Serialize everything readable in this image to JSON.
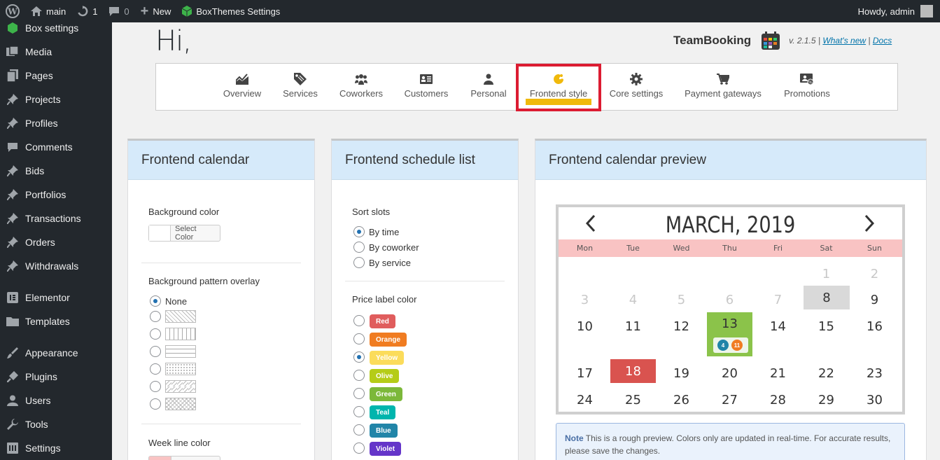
{
  "adminbar": {
    "site_name": "main",
    "updates_count": "1",
    "comments_count": "0",
    "new_label": "New",
    "plugin_label": "BoxThemes Settings",
    "howdy": "Howdy, admin"
  },
  "sidebar": {
    "items": [
      {
        "label": "Box settings",
        "icon": "cube-icon"
      },
      {
        "label": "Media",
        "icon": "media-icon"
      },
      {
        "label": "Pages",
        "icon": "pages-icon"
      },
      {
        "label": "Projects",
        "icon": "pin-icon"
      },
      {
        "label": "Profiles",
        "icon": "pin-icon"
      },
      {
        "label": "Comments",
        "icon": "comment-icon"
      },
      {
        "label": "Bids",
        "icon": "pin-icon"
      },
      {
        "label": "Portfolios",
        "icon": "pin-icon"
      },
      {
        "label": "Transactions",
        "icon": "pin-icon"
      },
      {
        "label": "Orders",
        "icon": "pin-icon"
      },
      {
        "label": "Withdrawals",
        "icon": "pin-icon"
      },
      {
        "label": "Elementor",
        "icon": "elementor-icon"
      },
      {
        "label": "Templates",
        "icon": "folder-icon"
      },
      {
        "label": "Appearance",
        "icon": "brush-icon"
      },
      {
        "label": "Plugins",
        "icon": "plug-icon"
      },
      {
        "label": "Users",
        "icon": "user-icon"
      },
      {
        "label": "Tools",
        "icon": "wrench-icon"
      },
      {
        "label": "Settings",
        "icon": "settings-icon"
      }
    ]
  },
  "header": {
    "greeting": "Hi,",
    "brand": "TeamBooking",
    "version": "v. 2.1.5 |",
    "whats_new": "What's new",
    "divider": "|",
    "docs": "Docs"
  },
  "tabs": [
    {
      "label": "Overview",
      "icon": "chart-icon",
      "active": false
    },
    {
      "label": "Services",
      "icon": "tag-icon",
      "active": false
    },
    {
      "label": "Coworkers",
      "icon": "group-icon",
      "active": false
    },
    {
      "label": "Customers",
      "icon": "card-icon",
      "active": false
    },
    {
      "label": "Personal",
      "icon": "person-icon",
      "active": false
    },
    {
      "label": "Frontend style",
      "icon": "palette-icon",
      "active": true
    },
    {
      "label": "Core settings",
      "icon": "gear-icon",
      "active": false
    },
    {
      "label": "Payment gateways",
      "icon": "cart-icon",
      "active": false
    },
    {
      "label": "Promotions",
      "icon": "promo-icon",
      "active": false
    }
  ],
  "panel_calendar": {
    "title": "Frontend calendar",
    "bg_color_label": "Background color",
    "select_color": "Select Color",
    "pattern_label": "Background pattern overlay",
    "pattern_none": "None",
    "week_line_label": "Week line color"
  },
  "panel_schedule": {
    "title": "Frontend schedule list",
    "sort_label": "Sort slots",
    "sort_options": [
      "By time",
      "By coworker",
      "By service"
    ],
    "sort_selected": "By time",
    "price_label": "Price label color",
    "price_options": [
      {
        "name": "Red",
        "color": "#e05d5d"
      },
      {
        "name": "Orange",
        "color": "#f07c21"
      },
      {
        "name": "Yellow",
        "color": "#fbdc5b"
      },
      {
        "name": "Olive",
        "color": "#b5cc18"
      },
      {
        "name": "Green",
        "color": "#7cb83a"
      },
      {
        "name": "Teal",
        "color": "#00b5ad"
      },
      {
        "name": "Blue",
        "color": "#2185a8"
      },
      {
        "name": "Violet",
        "color": "#6435c9"
      }
    ],
    "price_selected": "Yellow"
  },
  "panel_preview": {
    "title": "Frontend calendar preview",
    "month": "MARCH, 2019",
    "prev": "‹",
    "next": "›",
    "weekdays": [
      "Mon",
      "Tue",
      "Wed",
      "Thu",
      "Fri",
      "Sat",
      "Sun"
    ],
    "badges": {
      "a": "4",
      "b": "11"
    },
    "note_label": "Note",
    "note_text": "This is a rough preview. Colors only are updated in real-time. For accurate results, please save the changes."
  }
}
